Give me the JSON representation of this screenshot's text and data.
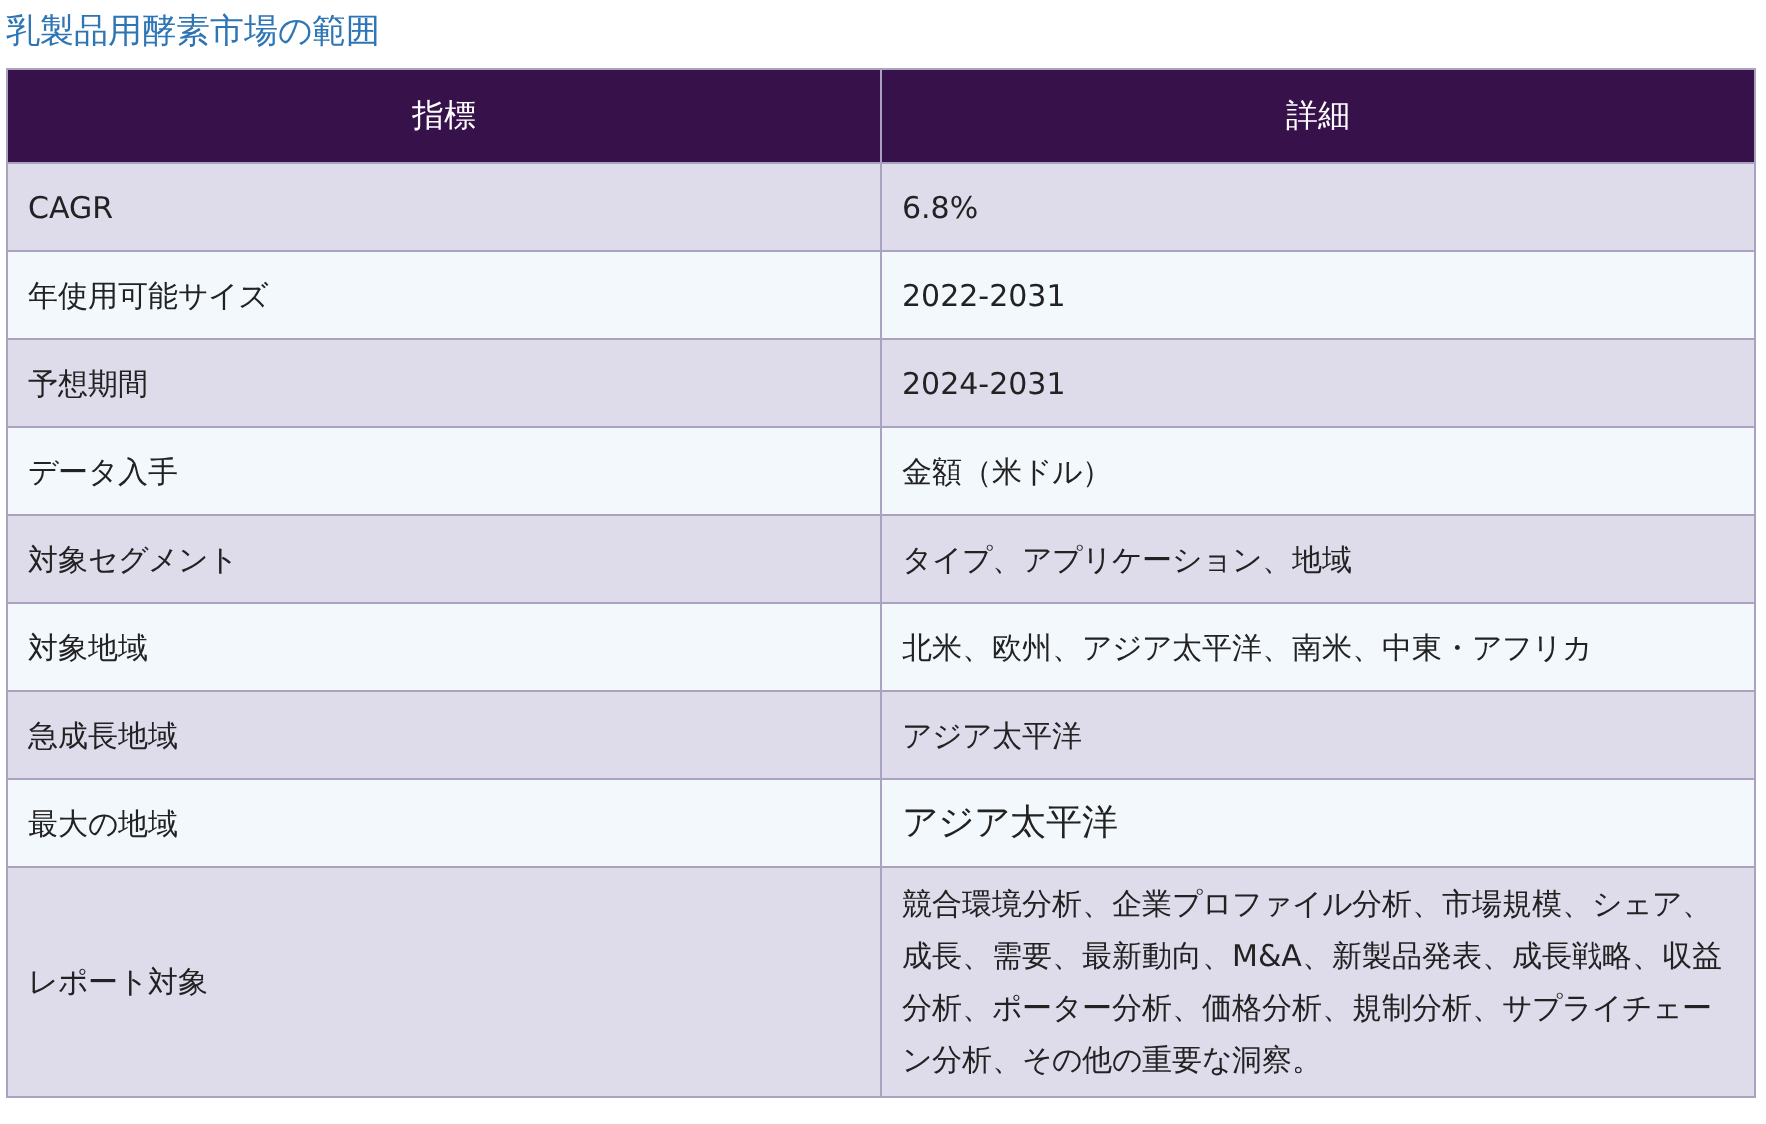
{
  "title": "乳製品用酵素市場の範囲",
  "table": {
    "columns": [
      "指標",
      "詳細"
    ],
    "rows": [
      {
        "label": "CAGR",
        "value": "6.8%",
        "large_text": false
      },
      {
        "label": "年使用可能サイズ",
        "value": "2022-2031",
        "large_text": false
      },
      {
        "label": "予想期間",
        "value": "2024-2031",
        "large_text": false
      },
      {
        "label": "データ入手",
        "value": "金額（米ドル）",
        "large_text": false
      },
      {
        "label": "対象セグメント",
        "value": "タイプ、アプリケーション、地域",
        "large_text": false
      },
      {
        "label": "対象地域",
        "value": "北米、欧州、アジア太平洋、南米、中東・アフリカ",
        "large_text": false
      },
      {
        "label": "急成長地域",
        "value": "アジア太平洋",
        "large_text": false
      },
      {
        "label": "最大の地域",
        "value": "アジア太平洋",
        "large_text": true
      },
      {
        "label": "レポート対象",
        "value": "競合環境分析、企業プロファイル分析、市場規模、シェア、成長、需要、最新動向、M&A、新製品発表、成長戦略、収益分析、ポーター分析、価格分析、規制分析、サプライチェーン分析、その他の重要な洞察。",
        "large_text": false
      }
    ]
  }
}
